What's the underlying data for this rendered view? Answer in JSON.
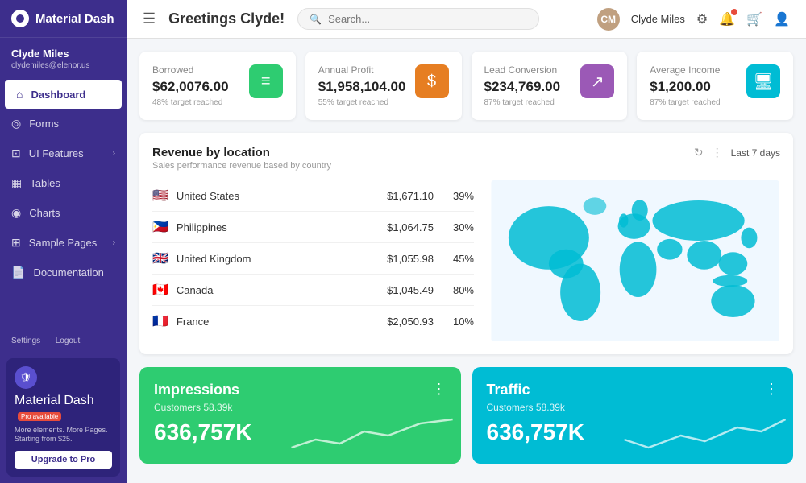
{
  "sidebar": {
    "logo": "Material Dash",
    "user": {
      "name": "Clyde Miles",
      "email": "clydemiles@elenor.us"
    },
    "nav": [
      {
        "id": "dashboard",
        "label": "Dashboard",
        "icon": "⊞",
        "active": true
      },
      {
        "id": "forms",
        "label": "Forms",
        "icon": "◎"
      },
      {
        "id": "ui-features",
        "label": "UI Features",
        "icon": "⊡",
        "hasChildren": true
      },
      {
        "id": "tables",
        "label": "Tables",
        "icon": "▦"
      },
      {
        "id": "charts",
        "label": "Charts",
        "icon": "◉"
      },
      {
        "id": "sample-pages",
        "label": "Sample Pages",
        "icon": "⊞",
        "hasChildren": true
      },
      {
        "id": "documentation",
        "label": "Documentation",
        "icon": "📄"
      }
    ],
    "footer": {
      "settings": "Settings",
      "logout": "Logout"
    },
    "promo": {
      "title": "Material Dash",
      "badge": "Pro available",
      "desc": "More elements. More Pages. Starting from $25.",
      "button": "Upgrade to Pro"
    }
  },
  "header": {
    "greeting": "Greetings Clyde!",
    "search_placeholder": "Search...",
    "user": "Clyde Miles",
    "icons": [
      "gear",
      "bell",
      "cart",
      "profile"
    ]
  },
  "stats": [
    {
      "label": "Borrowed",
      "value": "$62,0076.00",
      "sub": "48% target reached",
      "icon": "≡",
      "color": "green-bg"
    },
    {
      "label": "Annual Profit",
      "value": "$1,958,104.00",
      "sub": "55% target reached",
      "icon": "$",
      "color": "orange-bg"
    },
    {
      "label": "Lead Conversion",
      "value": "$234,769.00",
      "sub": "87% target reached",
      "icon": "↗",
      "color": "purple-bg"
    },
    {
      "label": "Average Income",
      "value": "$1,200.00",
      "sub": "87% target reached",
      "icon": "🖥",
      "color": "cyan-bg"
    }
  ],
  "revenue": {
    "title": "Revenue by location",
    "subtitle": "Sales performance revenue based by country",
    "filter": "Last 7 days",
    "countries": [
      {
        "flag": "🇺🇸",
        "name": "United States",
        "amount": "$1,671.10",
        "pct": "39%"
      },
      {
        "flag": "🇵🇭",
        "name": "Philippines",
        "amount": "$1,064.75",
        "pct": "30%"
      },
      {
        "flag": "🇬🇧",
        "name": "United Kingdom",
        "amount": "$1,055.98",
        "pct": "45%"
      },
      {
        "flag": "🇨🇦",
        "name": "Canada",
        "amount": "$1,045.49",
        "pct": "80%"
      },
      {
        "flag": "🇫🇷",
        "name": "France",
        "amount": "$2,050.93",
        "pct": "10%"
      }
    ]
  },
  "metrics": [
    {
      "id": "impressions",
      "title": "Impressions",
      "sub": "Customers 58.39k",
      "value": "636,757K",
      "color": "green"
    },
    {
      "id": "traffic",
      "title": "Traffic",
      "sub": "Customers 58.39k",
      "value": "636,757K",
      "color": "teal"
    }
  ]
}
